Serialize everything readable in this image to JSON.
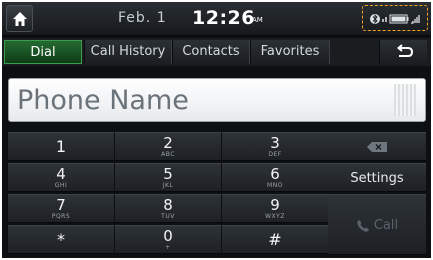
{
  "status": {
    "date": "Feb. 1",
    "time": "12:26",
    "ampm": "AM"
  },
  "icons": {
    "home": "home-icon",
    "status": "bluetooth-battery-signal-icon",
    "back": "back-arrow-icon",
    "delete": "backspace-icon",
    "call": "phone-handset-icon"
  },
  "tabs": [
    {
      "label": "Dial",
      "active": true
    },
    {
      "label": "Call History",
      "active": false
    },
    {
      "label": "Contacts",
      "active": false
    },
    {
      "label": "Favorites",
      "active": false
    }
  ],
  "input": {
    "placeholder": "Phone Name",
    "value": ""
  },
  "keypad": [
    {
      "digit": "1",
      "letters": ""
    },
    {
      "digit": "2",
      "letters": "ABC"
    },
    {
      "digit": "3",
      "letters": "DEF"
    },
    {
      "digit": "4",
      "letters": "GHI"
    },
    {
      "digit": "5",
      "letters": "JKL"
    },
    {
      "digit": "6",
      "letters": "MNO"
    },
    {
      "digit": "7",
      "letters": "PQRS"
    },
    {
      "digit": "8",
      "letters": "TUV"
    },
    {
      "digit": "9",
      "letters": "WXYZ"
    },
    {
      "digit": "*",
      "letters": ""
    },
    {
      "digit": "0",
      "letters": "+"
    },
    {
      "digit": "#",
      "letters": ""
    }
  ],
  "side": {
    "settings_label": "Settings",
    "call_label": "Call"
  },
  "colors": {
    "active_tab": "#1f6a2e",
    "status_highlight": "#f2a11f",
    "background": "#0d1013"
  }
}
